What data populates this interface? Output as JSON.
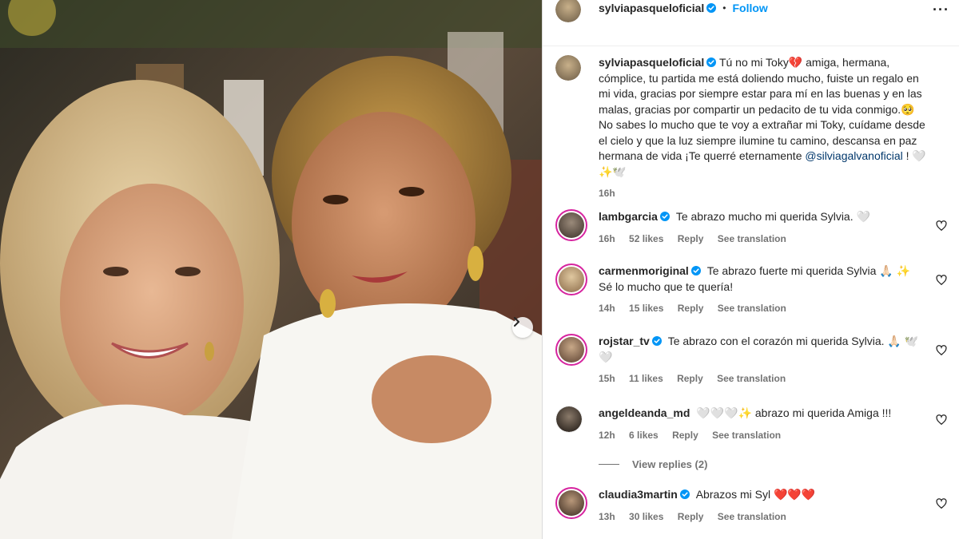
{
  "post": {
    "author": "sylviapasqueloficial",
    "follow_label": "Follow",
    "separator": "•",
    "more_label": "···",
    "caption_text": "Tú no mi Toky💔 amiga, hermana, cómplice, tu partida me está doliendo mucho, fuiste un regalo en mi vida, gracias por siempre estar para mí en las buenas y en las malas, gracias por compartir un pedacito de tu vida conmigo.🥺 No sabes lo mucho que te voy a extrañar mi Toky, cuídame desde el cielo y que la luz siempre ilumine tu camino, descansa en paz hermana de vida ¡Te querré eternamente",
    "caption_mention": "@silviagalvanoficial",
    "caption_end": " ! 🤍✨🕊️",
    "caption_time": "16h"
  },
  "comments": [
    {
      "user": "lambgarcia",
      "verified": true,
      "text": "Te abrazo mucho mi querida Sylvia. 🤍",
      "time": "16h",
      "likes": "52 likes",
      "reply": "Reply",
      "translate": "See translation"
    },
    {
      "user": "carmenmoriginal",
      "verified": true,
      "text": "Te abrazo fuerte mi querida Sylvia 🙏🏻 ✨ Sé lo mucho que te quería!",
      "time": "14h",
      "likes": "15 likes",
      "reply": "Reply",
      "translate": "See translation"
    },
    {
      "user": "rojstar_tv",
      "verified": true,
      "text": "Te abrazo con el corazón mi querida Sylvia. 🙏🏻 🕊️ 🤍",
      "time": "15h",
      "likes": "11 likes",
      "reply": "Reply",
      "translate": "See translation"
    },
    {
      "user": "angeldeanda_md",
      "verified": false,
      "text": "🤍🤍🤍✨ abrazo mi querida Amiga !!!",
      "time": "12h",
      "likes": "6 likes",
      "reply": "Reply",
      "translate": "See translation"
    },
    {
      "user": "claudia3martin",
      "verified": true,
      "text": "Abrazos mi Syl ❤️❤️❤️",
      "time": "13h",
      "likes": "30 likes",
      "reply": "Reply",
      "translate": "See translation"
    }
  ],
  "view_replies": "View replies (2)",
  "icons": {
    "verified": "verified-badge-icon",
    "like": "heart-outline-icon",
    "next": "chevron-right-icon",
    "more": "more-options-icon"
  },
  "colors": {
    "link": "#0095f6",
    "verified": "#0095f6",
    "muted": "#737373",
    "ring": "#d6249f"
  }
}
